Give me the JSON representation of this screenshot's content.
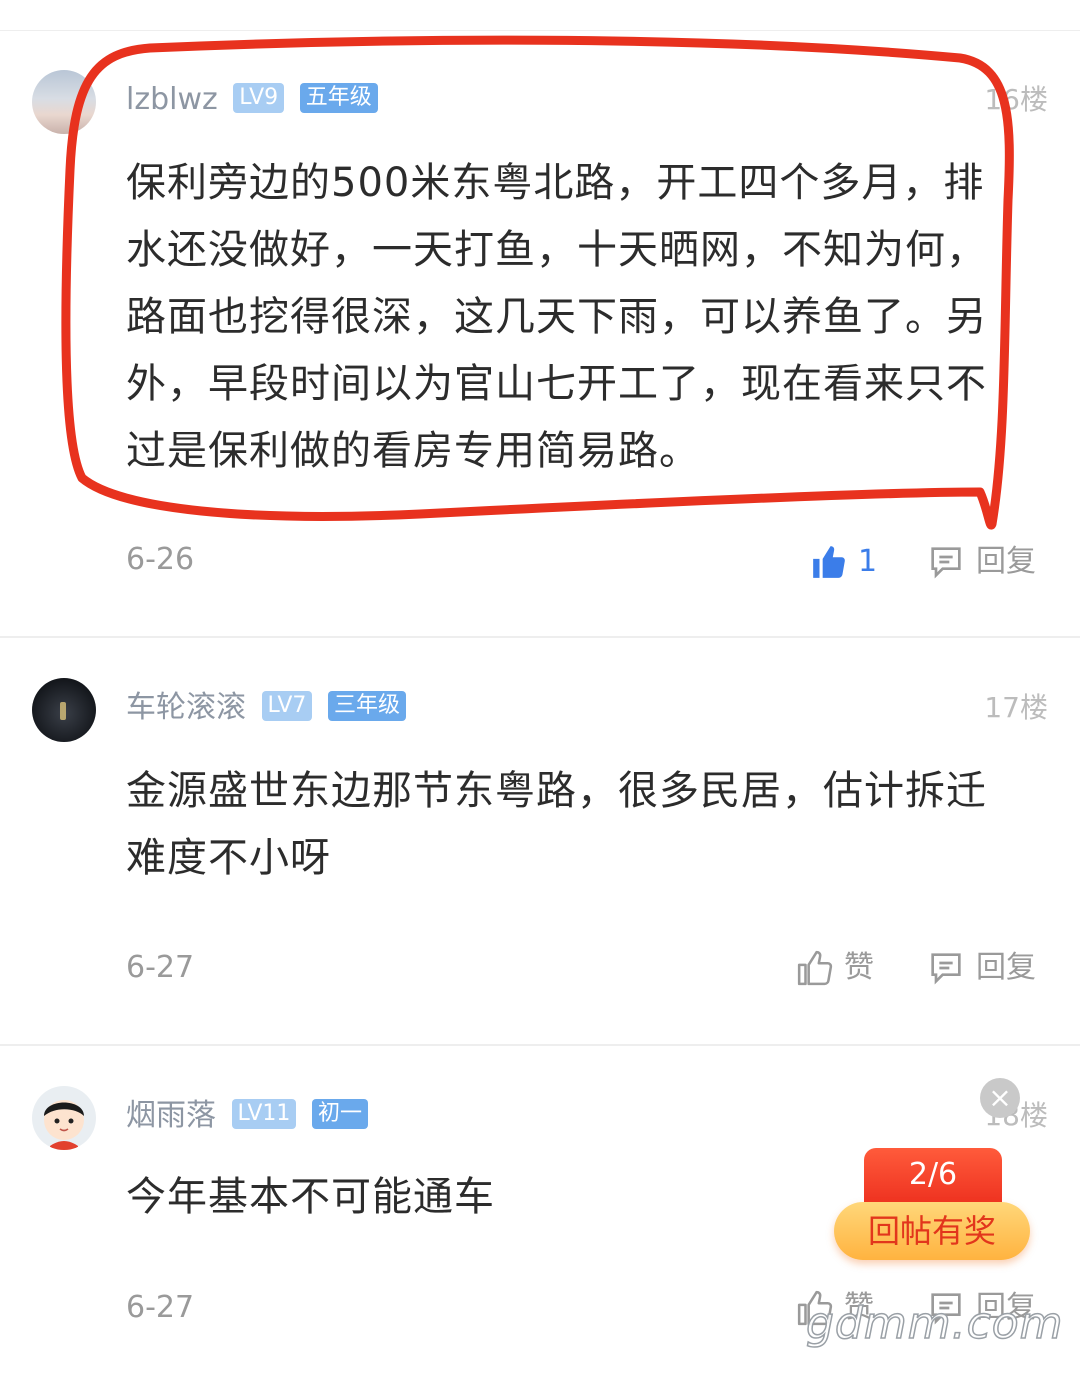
{
  "posts": [
    {
      "username": "lzblwz",
      "level": "LV9",
      "grade": "五年级",
      "floor": "16楼",
      "content": "保利旁边的500米东粤北路，开工四个多月，排水还没做好，一天打鱼，十天晒网，不知为何，路面也挖得很深，这几天下雨，可以养鱼了。另外，早段时间以为官山七开工了，现在看来只不过是保利做的看房专用简易路。",
      "date": "6-26",
      "like_label": "1",
      "reply_label": "回复"
    },
    {
      "username": "车轮滚滚",
      "level": "LV7",
      "grade": "三年级",
      "floor": "17楼",
      "content": "金源盛世东边那节东粤路，很多民居，估计拆迁难度不小呀",
      "date": "6-27",
      "like_label": "赞",
      "reply_label": "回复"
    },
    {
      "username": "烟雨落",
      "level": "LV11",
      "grade": "初一",
      "floor": "18楼",
      "content": "今年基本不可能通车",
      "date": "6-27",
      "like_label": "赞",
      "reply_label": "回复"
    }
  ],
  "reward_widget": {
    "close": "×",
    "count": "2/6",
    "label": "回帖有奖"
  },
  "watermark": "gdmm.com",
  "colors": {
    "annotation": "#e8321e",
    "liked": "#3b7de9",
    "level_badge": "#a8cdf3",
    "grade_badge": "#6aa9ec"
  },
  "icons": {
    "like_active": "thumbs-up-filled-icon",
    "like": "thumbs-up-outline-icon",
    "reply": "comment-bubble-icon",
    "close": "close-icon"
  }
}
